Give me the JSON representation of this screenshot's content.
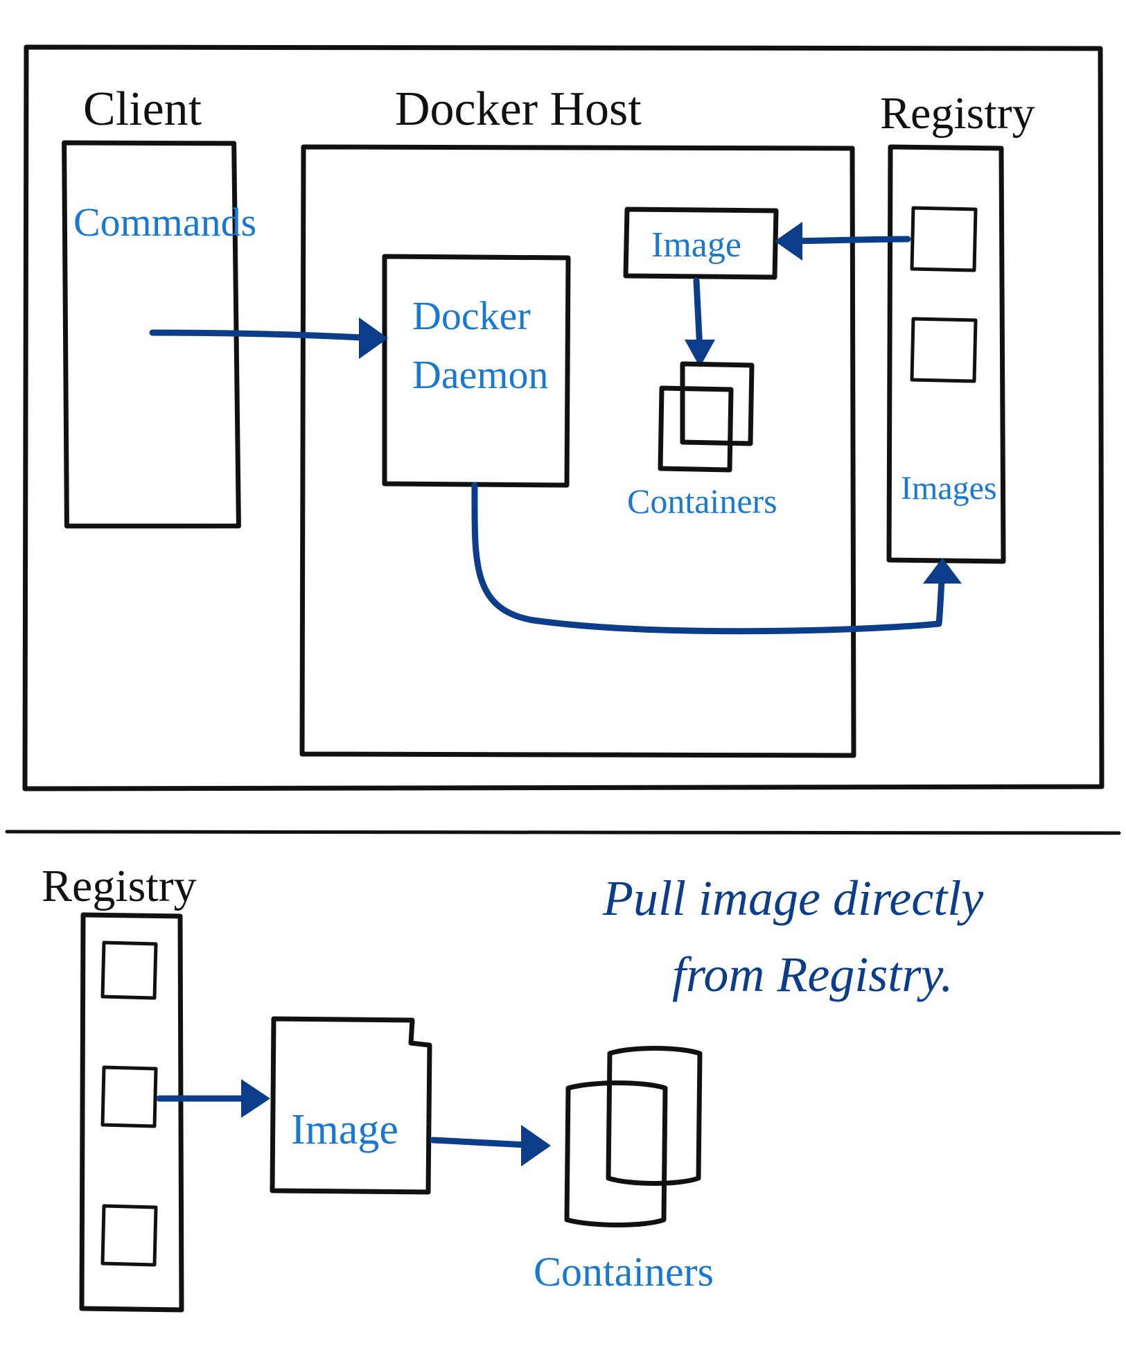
{
  "top": {
    "client_title": "Client",
    "client_label": "Commands",
    "host_title": "Docker Host",
    "daemon_label1": "Docker",
    "daemon_label2": "Daemon",
    "image_label": "Image",
    "containers_label": "Containers",
    "registry_title": "Registry",
    "registry_images_label": "Images"
  },
  "bottom": {
    "registry_title": "Registry",
    "image_label": "Image",
    "containers_label": "Containers",
    "note_line1": "Pull image directly",
    "note_line2": "from Registry."
  }
}
